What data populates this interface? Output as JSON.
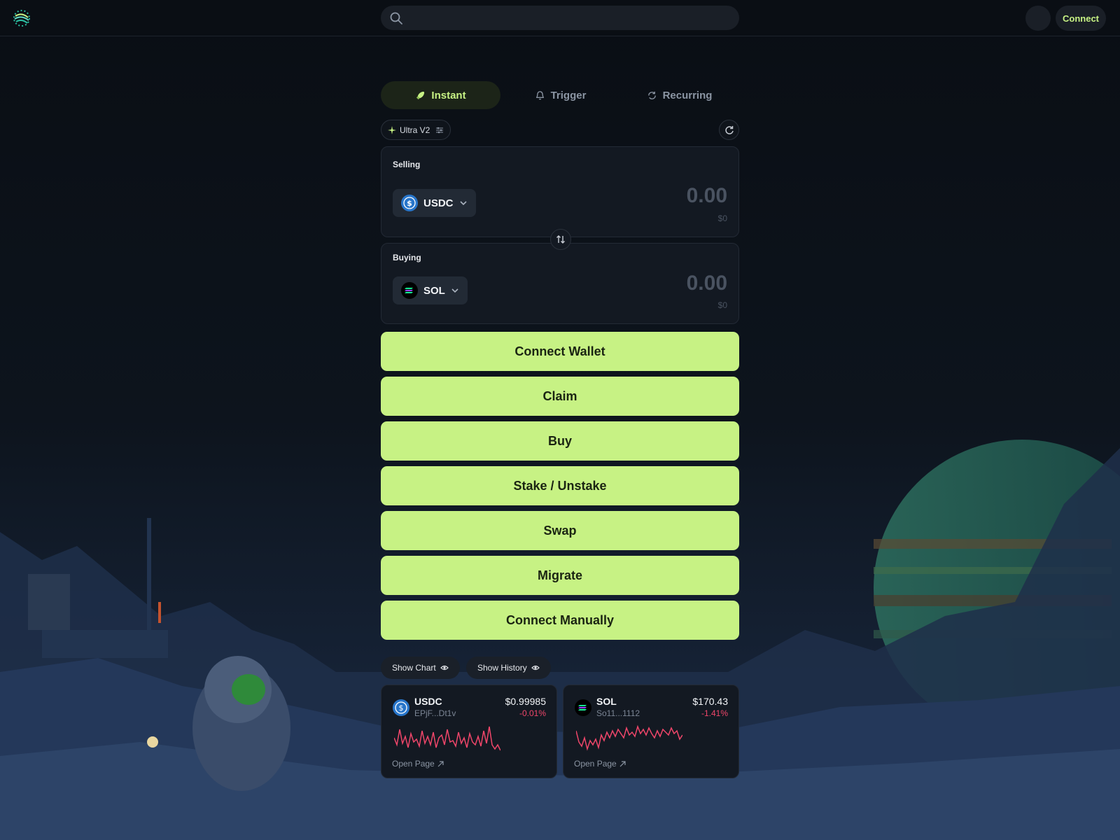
{
  "header": {
    "logo_icon": "jupiter-logo-icon",
    "search_placeholder": "",
    "connect_label": "Connect"
  },
  "tabs": [
    {
      "label": "Instant",
      "icon": "rocket-icon",
      "active": true
    },
    {
      "label": "Trigger",
      "icon": "bell-icon",
      "active": false
    },
    {
      "label": "Recurring",
      "icon": "recurring-icon",
      "active": false
    }
  ],
  "router": {
    "label": "Ultra V2",
    "icon": "sparkle-icon",
    "settings_icon": "sliders-icon"
  },
  "selling": {
    "label": "Selling",
    "token": "USDC",
    "amount": "0.00",
    "usd": "$0"
  },
  "buying": {
    "label": "Buying",
    "token": "SOL",
    "amount": "0.00",
    "usd": "$0"
  },
  "actions": [
    "Connect Wallet",
    "Claim",
    "Buy",
    "Stake / Unstake",
    "Swap",
    "Migrate",
    "Connect Manually"
  ],
  "toggles": {
    "show_chart": "Show Chart",
    "show_history": "Show History"
  },
  "cards": [
    {
      "symbol": "USDC",
      "address": "EPjF...Dt1v",
      "price": "$0.99985",
      "change": "-0.01%",
      "open": "Open Page"
    },
    {
      "symbol": "SOL",
      "address": "So11...1112",
      "price": "$170.43",
      "change": "-1.41%",
      "open": "Open Page"
    }
  ],
  "colors": {
    "accent": "#c7f284",
    "background": "#0a0e14",
    "panel": "#131922",
    "negative": "#f0466a"
  }
}
